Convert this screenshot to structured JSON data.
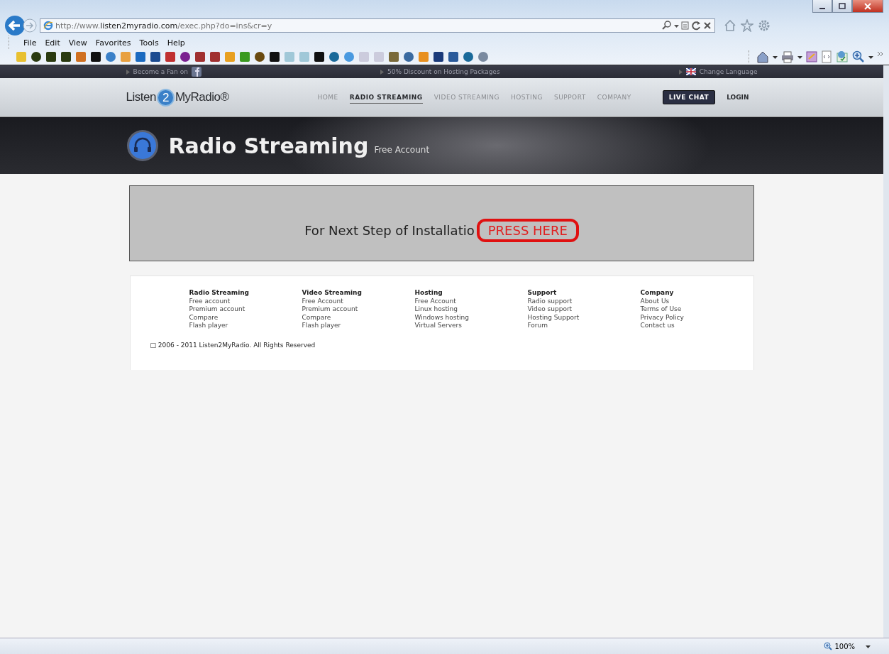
{
  "browser": {
    "address": {
      "prefix": "http://www.",
      "domain": "listen2myradio.com",
      "path": "/exec.php?do=ins&cr=y"
    },
    "menu": [
      "File",
      "Edit",
      "View",
      "Favorites",
      "Tools",
      "Help"
    ],
    "zoom": "100%"
  },
  "site": {
    "top_strip": {
      "fan": "Become a Fan on",
      "promo": "50% Discount on Hosting Packages",
      "language": "Change Language"
    },
    "logo": {
      "left": "Listen",
      "mark": "2",
      "right": "MyRadio®"
    },
    "nav": [
      {
        "label": "HOME",
        "selected": false
      },
      {
        "label": "RADIO STREAMING",
        "selected": true
      },
      {
        "label": "VIDEO STREAMING",
        "selected": false
      },
      {
        "label": "HOSTING",
        "selected": false
      },
      {
        "label": "SUPPORT",
        "selected": false
      },
      {
        "label": "COMPANY",
        "selected": false
      }
    ],
    "live_chat": "LIVE CHAT",
    "login": "LOGIN",
    "hero": {
      "title": "Radio Streaming",
      "subtitle": "Free Account"
    },
    "notice": {
      "text": "For Next Step of Installatio",
      "link": "PRESS HERE",
      "circled": true
    },
    "footer": {
      "columns": [
        {
          "heading": "Radio Streaming",
          "links": [
            "Free account",
            "Premium account",
            "Compare",
            "Flash player"
          ]
        },
        {
          "heading": "Video Streaming",
          "links": [
            "Free Account",
            "Premium account",
            "Compare",
            "Flash player"
          ]
        },
        {
          "heading": "Hosting",
          "links": [
            "Free Account",
            "Linux hosting",
            "Windows hosting",
            "Virtual Servers"
          ]
        },
        {
          "heading": "Support",
          "links": [
            "Radio support",
            "Video support",
            "Hosting Support",
            "Forum"
          ]
        },
        {
          "heading": "Company",
          "links": [
            "About Us",
            "Terms of Use",
            "Privacy Policy",
            "Contact us"
          ]
        }
      ],
      "copyright": "□ 2006 - 2011 Listen2MyRadio. All Rights Reserved"
    }
  }
}
